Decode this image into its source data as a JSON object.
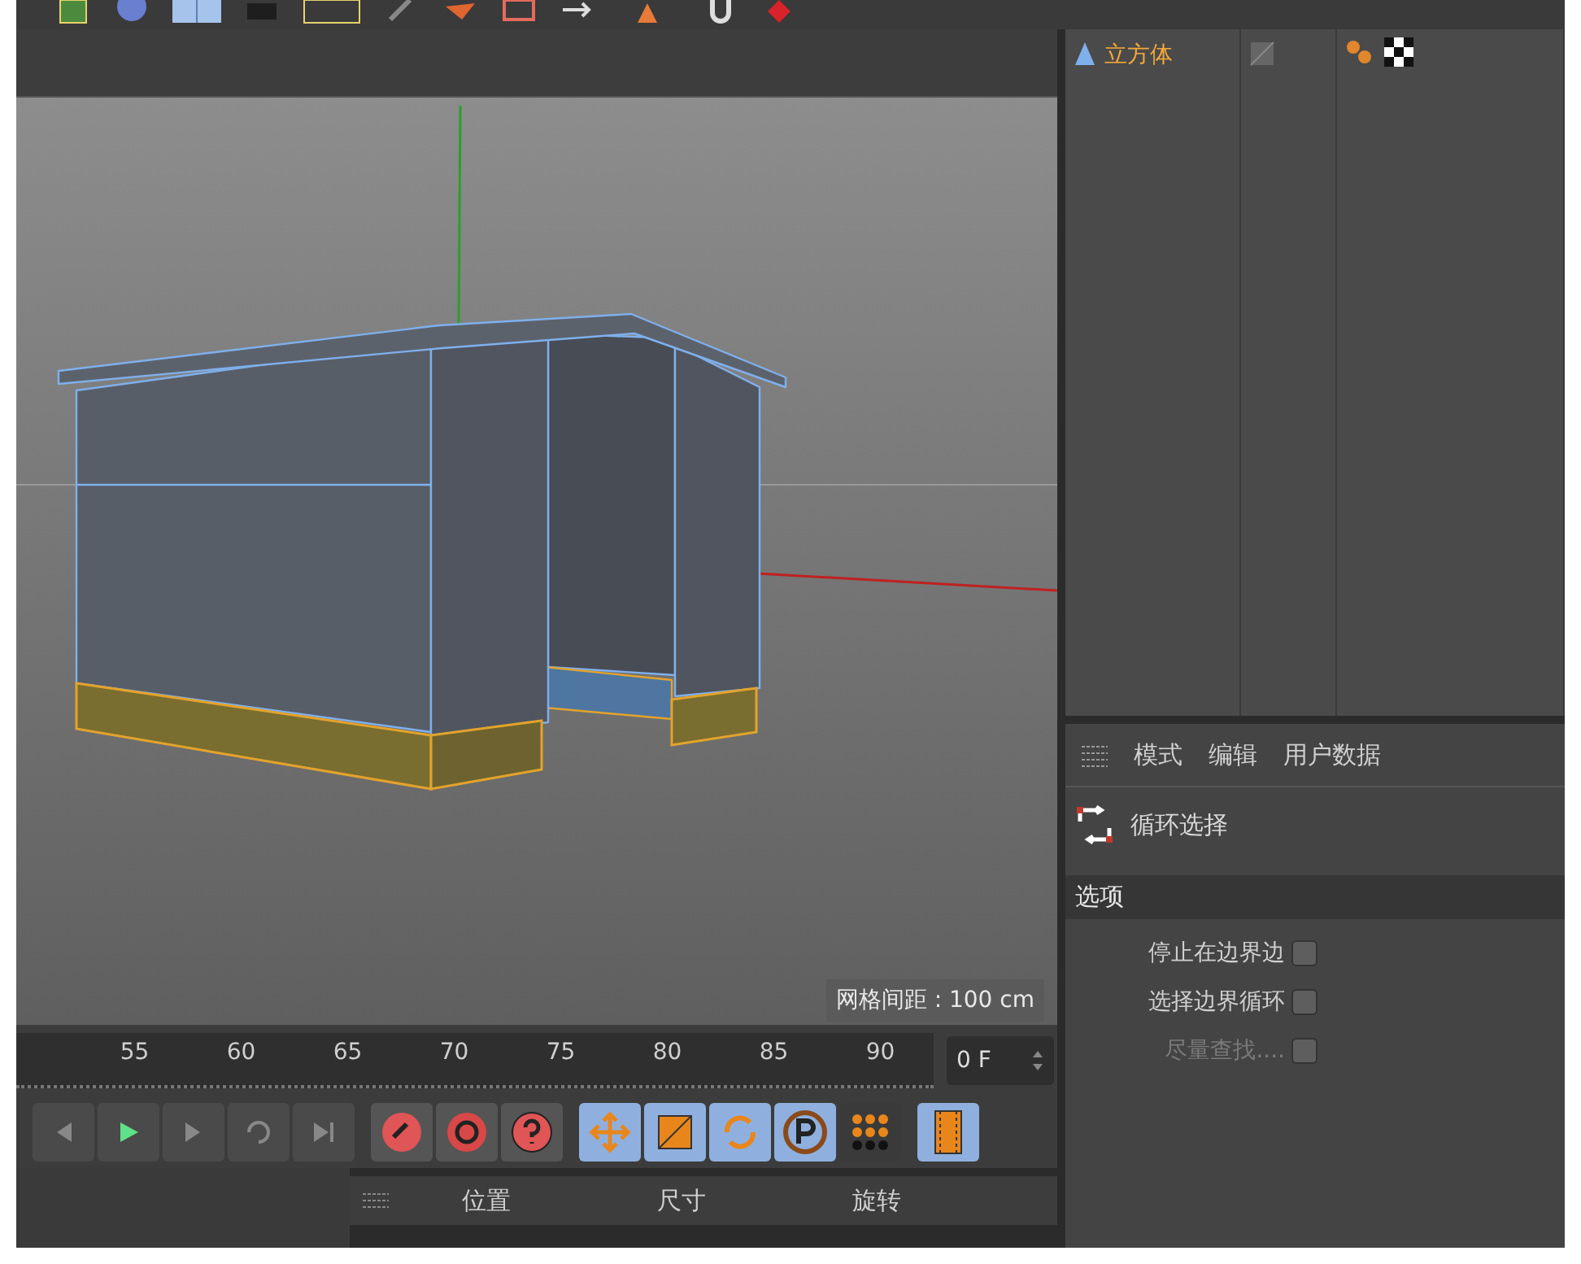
{
  "object_manager": {
    "objects": [
      {
        "name": "立方体",
        "selected": true
      }
    ]
  },
  "viewport": {
    "grid_spacing": "网格间距 : 100 cm"
  },
  "timeline": {
    "ticks": [
      "55",
      "60",
      "65",
      "70",
      "75",
      "80",
      "85",
      "90"
    ],
    "frame": "0 F"
  },
  "attributes": {
    "tabs": [
      "模式",
      "编辑",
      "用户数据"
    ],
    "tool_name": "循环选择",
    "section": "选项",
    "options": [
      {
        "label": "停止在边界边",
        "checked": false,
        "disabled": false
      },
      {
        "label": "选择边界循环",
        "checked": false,
        "disabled": false
      },
      {
        "label": "尽量查找....",
        "checked": false,
        "disabled": true
      }
    ]
  },
  "coordinates": {
    "columns": [
      "位置",
      "尺寸",
      "旋转"
    ]
  }
}
